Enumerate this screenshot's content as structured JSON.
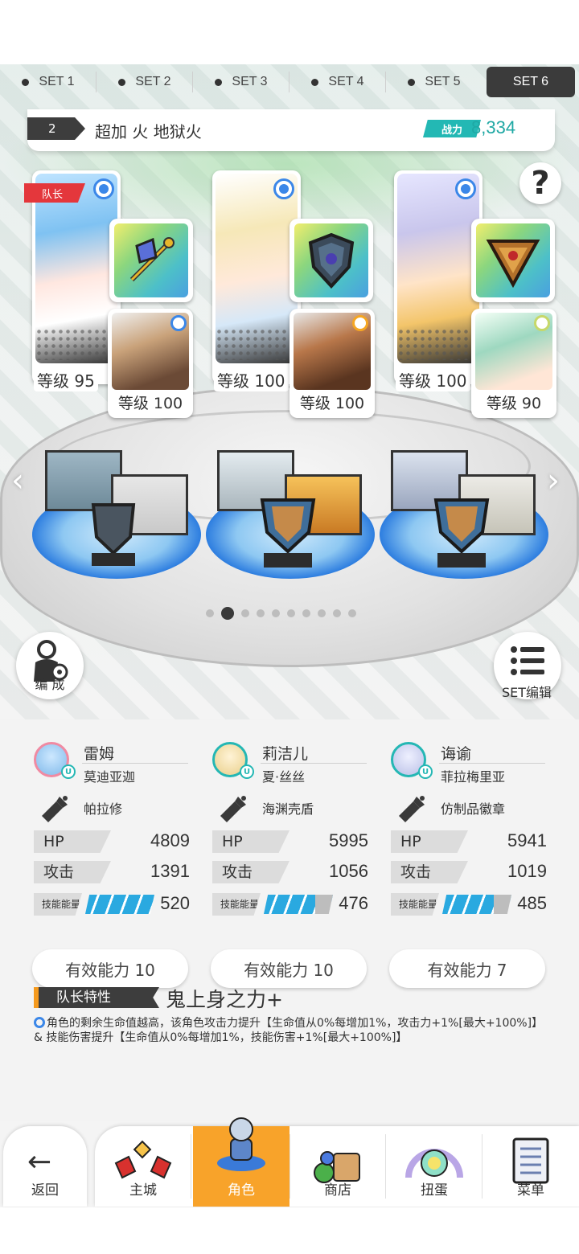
{
  "set_tabs": [
    {
      "label": "SET 1",
      "active": false
    },
    {
      "label": "SET 2",
      "active": false
    },
    {
      "label": "SET 3",
      "active": false
    },
    {
      "label": "SET 4",
      "active": false
    },
    {
      "label": "SET 5",
      "active": false
    },
    {
      "label": "SET 6",
      "active": true
    }
  ],
  "team": {
    "number": "2",
    "name": "超加 火 地狱火",
    "power_label": "战力",
    "power_value": "8,334"
  },
  "help_icon": "?",
  "leader_tag": "队长",
  "cards": [
    {
      "level": "等级 95",
      "pet_level": "等级 100"
    },
    {
      "level": "等级 100",
      "pet_level": "等级 100"
    },
    {
      "level": "等级 100",
      "pet_level": "等级 90"
    }
  ],
  "pager": {
    "total": 10,
    "active_index": 1
  },
  "formation_label": "编 成",
  "set_edit_label": "SET编辑",
  "members": [
    {
      "name": "雷姆",
      "pet": "莫迪亚迦",
      "gear": "帕拉修",
      "hp_label": "HP",
      "hp": "4809",
      "atk_label": "攻击",
      "atk": "1391",
      "energy_label": "技能能量",
      "energy": "520",
      "effective": "有效能力 10"
    },
    {
      "name": "莉洁儿",
      "pet": "夏·丝丝",
      "gear": "海渊壳盾",
      "hp_label": "HP",
      "hp": "5995",
      "atk_label": "攻击",
      "atk": "1056",
      "energy_label": "技能能量",
      "energy": "476",
      "effective": "有效能力 10"
    },
    {
      "name": "诲谕",
      "pet": "菲拉梅里亚",
      "gear": "仿制品徽章",
      "hp_label": "HP",
      "hp": "5941",
      "atk_label": "攻击",
      "atk": "1019",
      "energy_label": "技能能量",
      "energy": "485",
      "effective": "有效能力 7"
    }
  ],
  "leader_skill": {
    "label": "队长特性",
    "name": "鬼上身之力+",
    "description": "角色的剩余生命值越高，该角色攻击力提升【生命值从0%每增加1%，攻击力+1%[最大+100%]】 & 技能伤害提升【生命值从0%每增加1%，技能伤害+1%[最大+100%]】"
  },
  "nav": {
    "back": "返回",
    "items": [
      "主城",
      "角色",
      "商店",
      "扭蛋",
      "菜单"
    ],
    "active": "角色"
  },
  "colors": {
    "accent": "#f8a32a",
    "teal": "#23b8b4",
    "leader_red": "#e4373c",
    "energy_blue": "#2aa9e0"
  }
}
